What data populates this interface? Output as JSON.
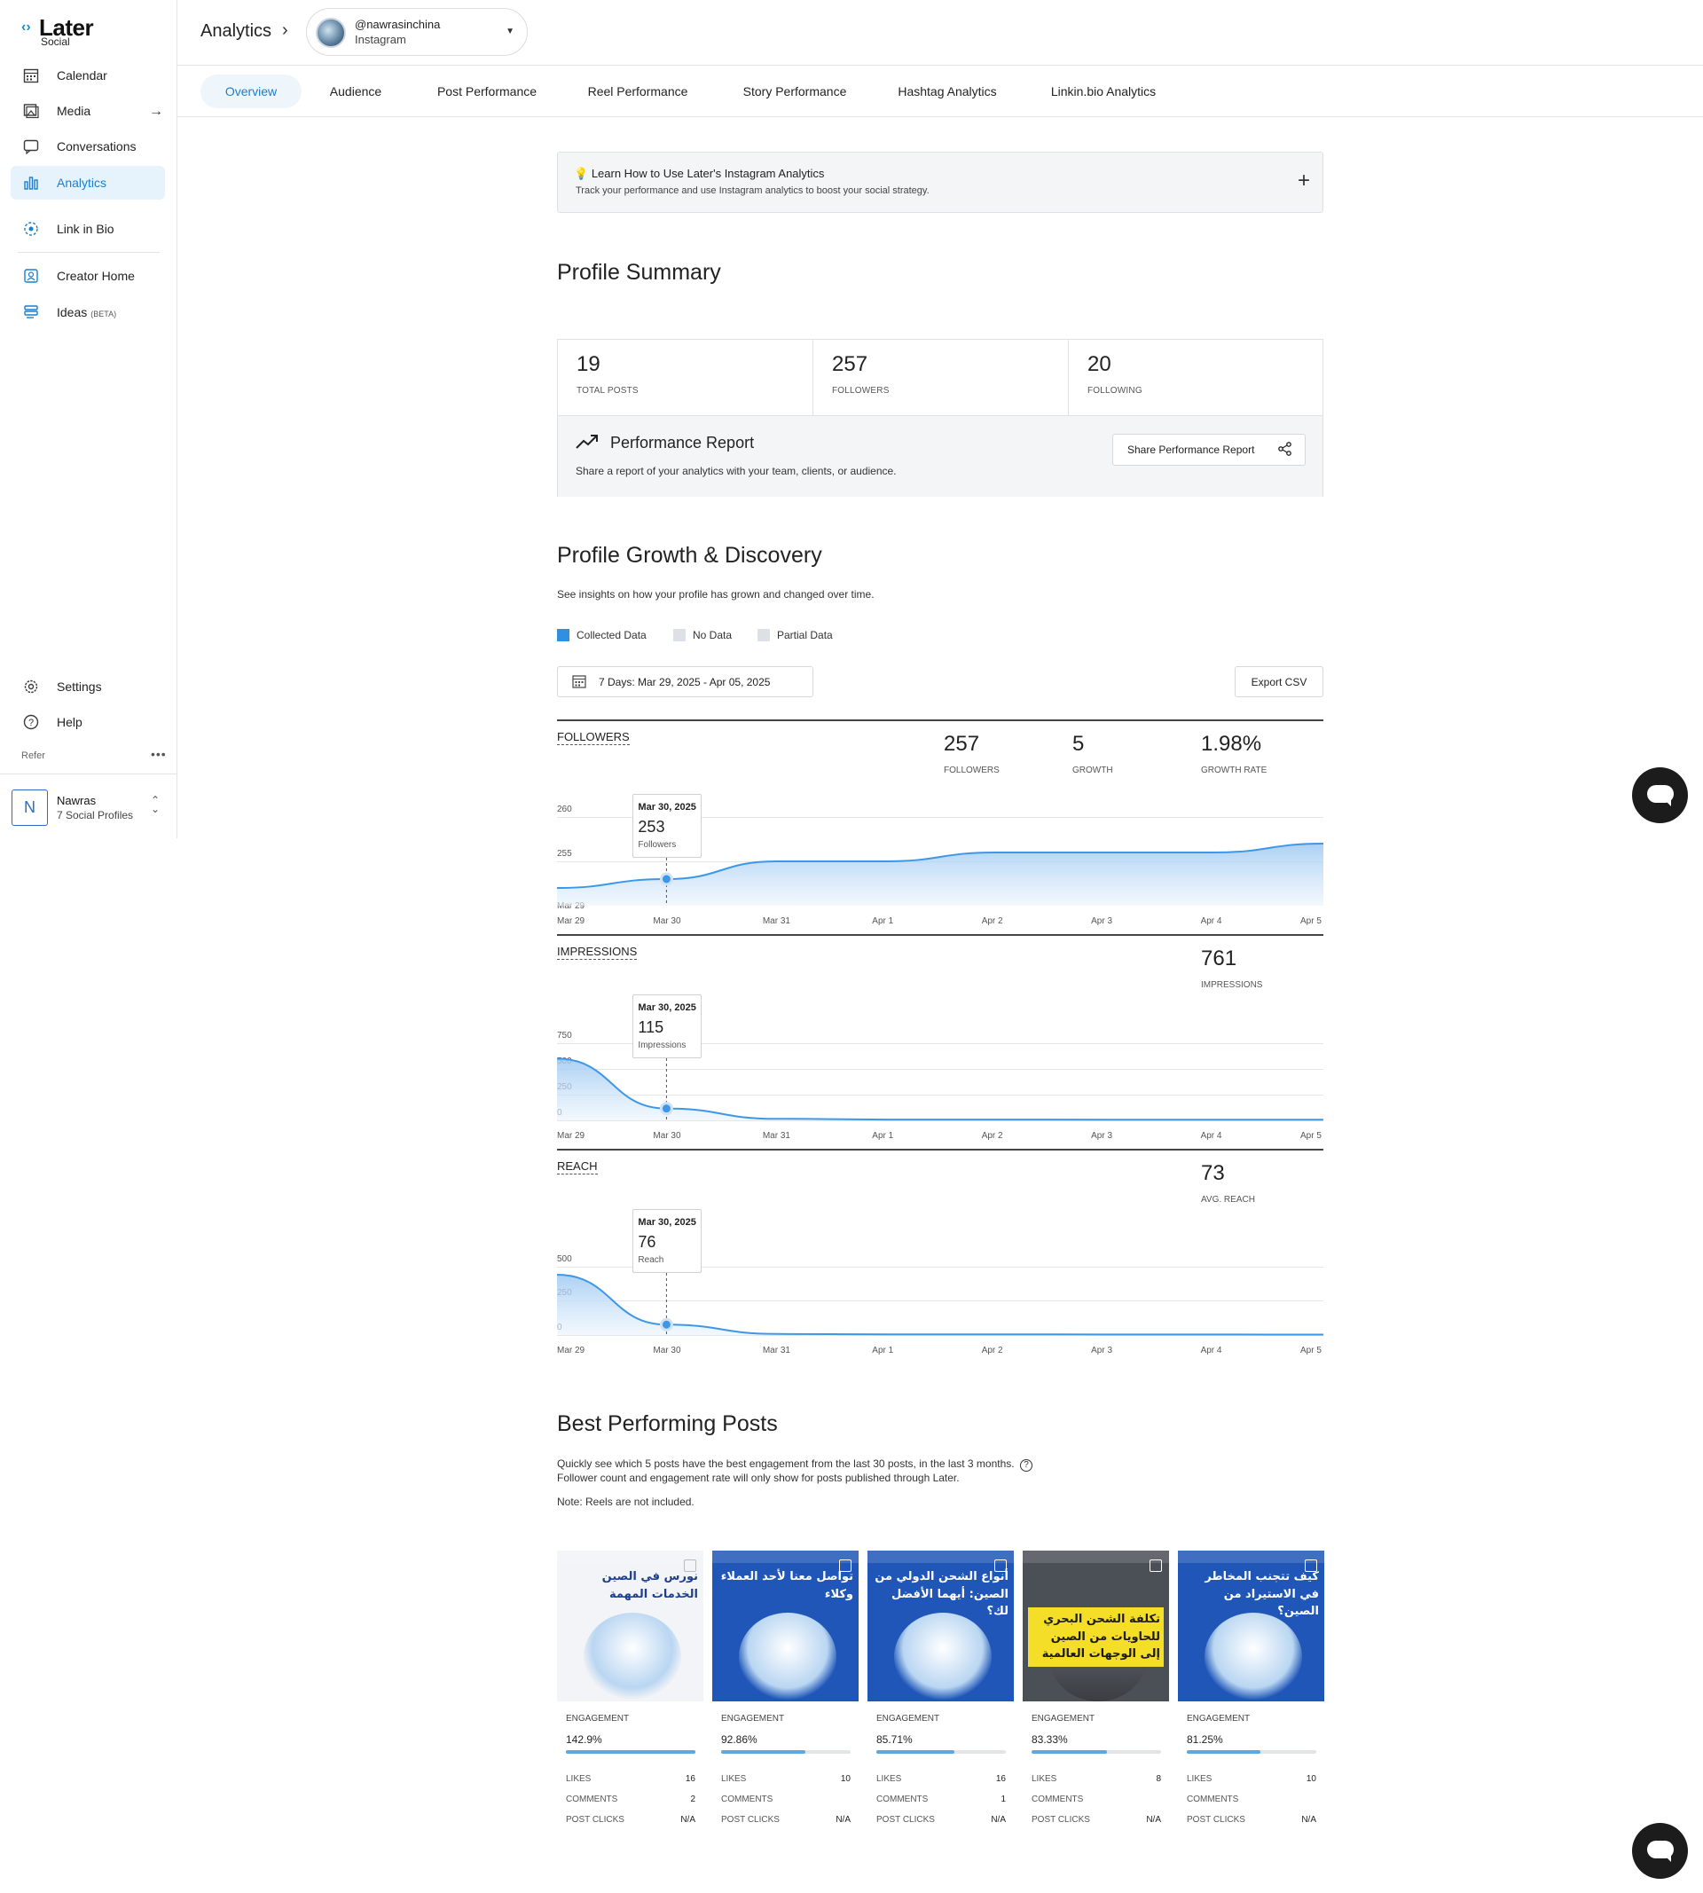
{
  "brand": {
    "name": "Later",
    "sub": "Social"
  },
  "sidebar": {
    "items": [
      {
        "label": "Calendar",
        "icon": "calendar-icon"
      },
      {
        "label": "Media",
        "icon": "image-icon"
      },
      {
        "label": "Conversations",
        "icon": "chat-icon"
      },
      {
        "label": "Analytics",
        "icon": "bar-chart-icon",
        "active": true
      },
      {
        "label": "Link in Bio",
        "icon": "link-icon"
      },
      {
        "label": "Creator Home",
        "icon": "creator-icon"
      },
      {
        "label": "Ideas",
        "badge": "(BETA)",
        "icon": "ideas-icon"
      }
    ],
    "bottom": [
      {
        "label": "Settings",
        "icon": "gear-icon"
      },
      {
        "label": "Help",
        "icon": "help-icon"
      }
    ],
    "refer": "Refer",
    "profile": {
      "initial": "N",
      "name": "Nawras",
      "sub": "7 Social Profiles"
    }
  },
  "header": {
    "title": "Analytics",
    "account": {
      "handle": "@nawrasinchina",
      "network": "Instagram"
    }
  },
  "tabs": [
    "Overview",
    "Audience",
    "Post Performance",
    "Reel Performance",
    "Story Performance",
    "Hashtag Analytics",
    "Linkin.bio Analytics"
  ],
  "learn": {
    "title": "Learn How to Use Later's Instagram Analytics",
    "subtitle": "Track your performance and use Instagram analytics to boost your social strategy."
  },
  "profile_summary": {
    "title": "Profile Summary",
    "stats": [
      {
        "value": "19",
        "label": "TOTAL POSTS"
      },
      {
        "value": "257",
        "label": "FOLLOWERS"
      },
      {
        "value": "20",
        "label": "FOLLOWING"
      }
    ],
    "report": {
      "title": "Performance Report",
      "subtitle": "Share a report of your analytics with your team, clients, or audience.",
      "button": "Share Performance Report"
    }
  },
  "growth": {
    "title": "Profile Growth & Discovery",
    "subtitle": "See insights on how your profile has grown and changed over time.",
    "legend": [
      {
        "label": "Collected Data",
        "color": "#2f8fe0"
      },
      {
        "label": "No Data",
        "color": "#dde1e6"
      },
      {
        "label": "Partial Data",
        "color": "#dde1e6"
      }
    ],
    "date_range": "7 Days: Mar 29, 2025 - Apr 05, 2025",
    "export": "Export CSV",
    "x_labels": [
      "Mar 29",
      "Mar 30",
      "Mar 31",
      "Apr 1",
      "Apr 2",
      "Apr 3",
      "Apr 4",
      "Apr 5"
    ],
    "followers": {
      "name": "FOLLOWERS",
      "stats": [
        {
          "value": "257",
          "label": "FOLLOWERS"
        },
        {
          "value": "5",
          "label": "GROWTH"
        },
        {
          "value": "1.98%",
          "label": "GROWTH RATE"
        }
      ],
      "y_ticks": [
        "260",
        "255"
      ],
      "tooltip": {
        "date": "Mar 30, 2025",
        "value": "253",
        "label": "Followers"
      }
    },
    "impressions": {
      "name": "IMPRESSIONS",
      "stats": [
        {
          "value": "761",
          "label": "IMPRESSIONS"
        }
      ],
      "y_ticks": [
        "750",
        "500",
        "250",
        "0"
      ],
      "tooltip": {
        "date": "Mar 30, 2025",
        "value": "115",
        "label": "Impressions"
      }
    },
    "reach": {
      "name": "REACH",
      "stats": [
        {
          "value": "73",
          "label": "AVG. REACH"
        }
      ],
      "y_ticks": [
        "500",
        "250",
        "0"
      ],
      "tooltip": {
        "date": "Mar 30, 2025",
        "value": "76",
        "label": "Reach"
      }
    }
  },
  "chart_data": [
    {
      "type": "area",
      "title": "FOLLOWERS",
      "x": [
        "Mar 29",
        "Mar 30",
        "Mar 31",
        "Apr 1",
        "Apr 2",
        "Apr 3",
        "Apr 4",
        "Apr 5"
      ],
      "series": [
        {
          "name": "Followers",
          "values": [
            252,
            253,
            255,
            255,
            256,
            256,
            256,
            257
          ]
        }
      ],
      "ylim": [
        250,
        260
      ]
    },
    {
      "type": "area",
      "title": "IMPRESSIONS",
      "x": [
        "Mar 29",
        "Mar 30",
        "Mar 31",
        "Apr 1",
        "Apr 2",
        "Apr 3",
        "Apr 4",
        "Apr 5"
      ],
      "series": [
        {
          "name": "Impressions",
          "values": [
            600,
            115,
            15,
            8,
            8,
            7,
            7,
            6
          ]
        }
      ],
      "ylim": [
        0,
        1000
      ]
    },
    {
      "type": "area",
      "title": "REACH",
      "x": [
        "Mar 29",
        "Mar 30",
        "Mar 31",
        "Apr 1",
        "Apr 2",
        "Apr 3",
        "Apr 4",
        "Apr 5"
      ],
      "series": [
        {
          "name": "Reach",
          "values": [
            440,
            76,
            8,
            5,
            5,
            4,
            4,
            3
          ]
        }
      ],
      "ylim": [
        0,
        750
      ]
    }
  ],
  "best_posts": {
    "title": "Best Performing Posts",
    "desc1": "Quickly see which 5 posts have the best engagement from the last 30 posts, in the last 3 months.",
    "desc2": "Follower count and engagement rate will only show for posts published through Later.",
    "note": "Note: Reels are not included.",
    "labels": {
      "engagement": "ENGAGEMENT",
      "likes": "LIKES",
      "comments": "COMMENTS",
      "clicks": "POST CLICKS"
    },
    "posts": [
      {
        "engagement": "142.9%",
        "fraction": 1.0,
        "likes": "16",
        "comments": "2",
        "clicks": "N/A",
        "text": "ﻧﻮﺭﺱ ﻓﻲ ﺍﻟﺼﻴﻦ ﺍﻟﺨﺪﻣﺎﺕ ﺍﻟﻤﻬﻤﺔ",
        "bg": "#f3f4f7",
        "fg": "#1d3f8f"
      },
      {
        "engagement": "92.86%",
        "fraction": 0.65,
        "likes": "10",
        "comments": "",
        "clicks": "N/A",
        "text": "ﺗﻮﺍﺻﻞ ﻣﻌﻨﺎ ﻷﺣﺪ ﺍﻟﻌﻤﻼﺀ ﻭﻛﻼﺀ",
        "bg": "#1f56b8",
        "fg": "#ffffff"
      },
      {
        "engagement": "85.71%",
        "fraction": 0.6,
        "likes": "16",
        "comments": "1",
        "clicks": "N/A",
        "text": "ﺃﻧﻮﺍﻉ ﺍﻟﺸﺤﻦ ﺍﻟﺪﻭﻟﻲ ﻣﻦ ﺍﻟﺼﻴﻦ: ﺃﻳﻬﻤﺎ ﺍﻷﻓﻀﻞ ﻟﻚ؟",
        "bg": "#1f56b8",
        "fg": "#ffffff"
      },
      {
        "engagement": "83.33%",
        "fraction": 0.58,
        "likes": "8",
        "comments": "",
        "clicks": "N/A",
        "text": "ﺗﻜﻠﻔﺔ ﺍﻟﺸﺤﻦ ﺍﻟﺒﺤﺮﻱ ﻟﻠﺤﺎﻭﻳﺎﺕ ﻣﻦ ﺍﻟﺼﻴﻦ ﺇﻟﻰ ﺍﻟﻮﺟﻬﺎﺕ ﺍﻟﻌﺎﻟﻤﻴﺔ",
        "bg": "#4b4f56",
        "fg": "#1b1b1b"
      },
      {
        "engagement": "81.25%",
        "fraction": 0.57,
        "likes": "10",
        "comments": "",
        "clicks": "N/A",
        "text": "ﻛﻴﻒ ﺗﺘﺠﻨﺐ ﺍﻟﻤﺨﺎﻃﺮ ﻓﻲ ﺍﻻﺳﺘﻴﺮﺍﺩ ﻣﻦ ﺍﻟﺼﻴﻦ؟",
        "bg": "#1f56b8",
        "fg": "#ffffff"
      }
    ]
  },
  "colors": {
    "accent": "#1a7fd0",
    "chart_line": "#3d97e8",
    "chart_fill": "#cfe3f8"
  }
}
